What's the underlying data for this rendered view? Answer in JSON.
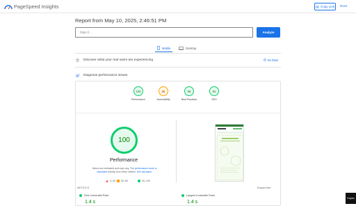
{
  "header": {
    "brand": "PageSpeed Insights",
    "copy_link_label": "Copy Link",
    "docs_label": "Docs"
  },
  "report": {
    "title": "Report from May 10, 2025, 2:46:51 PM",
    "url_value": "https://...",
    "analyze_label": "Analyze"
  },
  "tabs": [
    {
      "label": "Mobile",
      "active": true
    },
    {
      "label": "Desktop",
      "active": false
    }
  ],
  "real_users": {
    "text": "Discover what your real users are experiencing",
    "no_data_label": "No Data"
  },
  "diagnose": {
    "text": "Diagnose performance issues"
  },
  "categories": [
    {
      "label": "Performance",
      "score": "100",
      "color": "#0cce6b",
      "text_color": "#008800"
    },
    {
      "label": "Accessibility",
      "score": "85",
      "color": "#ffa400",
      "text_color": "#c33300"
    },
    {
      "label": "Best Practices",
      "score": "96",
      "color": "#0cce6b",
      "text_color": "#008800"
    },
    {
      "label": "SEO",
      "score": "92",
      "color": "#0cce6b",
      "text_color": "#008800"
    }
  ],
  "performance": {
    "score": "100",
    "title": "Performance",
    "note_prefix": "Values are estimated and may vary. The",
    "note_link1": "performance score is calculated",
    "note_mid": "directly from these metrics.",
    "note_link2": "See calculator.",
    "legend": [
      "0–49",
      "50–89",
      "90–100"
    ]
  },
  "metrics": {
    "label": "METRICS",
    "expand_label": "Expand view",
    "items": [
      {
        "name": "First Contentful Paint",
        "value": "1.4 s"
      },
      {
        "name": "Largest Contentful Paint",
        "value": "1.4 s"
      }
    ]
  },
  "keyboard_badge": "Keybo"
}
